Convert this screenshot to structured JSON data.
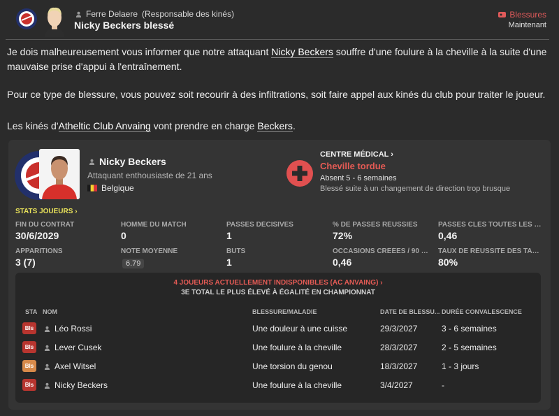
{
  "header": {
    "sender_name": "Ferre Delaere",
    "sender_role": "(Responsable des kinés)",
    "subject": "Nicky Beckers blessé",
    "category": "Blessures",
    "time": "Maintenant"
  },
  "message": {
    "p1_a": "Je dois malheureusement vous informer que notre attaquant ",
    "p1_link": "Nicky Beckers",
    "p1_b": " souffre d'une foulure à la cheville à la suite d'une mauvaise prise d'appui à l'entraînement.",
    "p2": "Pour ce type de blessure, vous pouvez soit recourir à des infiltrations, soit faire appel aux kinés du club pour traiter le joueur.",
    "p3_a": "Les kinés d'",
    "p3_club": "Atheltic Club Anvaing",
    "p3_b": " vont prendre en charge ",
    "p3_player": "Beckers",
    "p3_c": "."
  },
  "player": {
    "name": "Nicky Beckers",
    "description": "Attaquant enthousiaste de 21 ans",
    "nationality": "Belgique"
  },
  "medical": {
    "title": "CENTRE MÉDICAL",
    "injury": "Cheville tordue",
    "absence": "Absent 5 - 6 semaines",
    "cause": "Blessé suite à un changement de direction trop brusque"
  },
  "stats": {
    "title": "STATS JOUEURS",
    "items": [
      {
        "label": "FIN DU CONTRAT",
        "value": "30/6/2029"
      },
      {
        "label": "HOMME DU MATCH",
        "value": "0"
      },
      {
        "label": "PASSES DÉCISIVES",
        "value": "1"
      },
      {
        "label": "% DE PASSES RÉUSSIES",
        "value": "72%"
      },
      {
        "label": "PASSES CLÉS TOUTES LES 90...",
        "value": "0,46"
      },
      {
        "label": "APPARITIONS",
        "value": "3 (7)"
      },
      {
        "label": "NOTE MOYENNE",
        "value": "6.79"
      },
      {
        "label": "BUTS",
        "value": "1"
      },
      {
        "label": "OCCASIONS CRÉÉES / 90 MIN.",
        "value": "0,46"
      },
      {
        "label": "TAUX DE RÉUSSITE DES TACL...",
        "value": "80%"
      }
    ]
  },
  "unavailable": {
    "title": "4 JOUEURS ACTUELLEMENT INDISPONIBLES (AC ANVAING)",
    "subtitle": "3E TOTAL LE PLUS ÉLEVÉ À ÉGALITÉ EN CHAMPIONNAT",
    "columns": [
      "STA",
      "NOM",
      "BLESSURE/MALADIE",
      "DATE DE BLESSU...",
      "DURÉE CONVALESCENCE"
    ],
    "rows": [
      {
        "status": "Bls",
        "status_color": "#b8352f",
        "name": "Léo Rossi",
        "injury": "Une douleur à une cuisse",
        "date": "29/3/2027",
        "duration": "3 - 6 semaines"
      },
      {
        "status": "Bls",
        "status_color": "#b8352f",
        "name": "Lever Cusek",
        "injury": "Une foulure à la cheville",
        "date": "28/3/2027",
        "duration": "2 - 5 semaines"
      },
      {
        "status": "Bls",
        "status_color": "#d78a4a",
        "name": "Axel Witsel",
        "injury": "Une torsion du genou",
        "date": "18/3/2027",
        "duration": "1 - 3 jours"
      },
      {
        "status": "Bls",
        "status_color": "#b8352f",
        "name": "Nicky Beckers",
        "injury": "Une foulure à la cheville",
        "date": "3/4/2027",
        "duration": "-"
      }
    ]
  },
  "colors": {
    "accent_red": "#e55b55",
    "stats_title": "#e9e25a",
    "background": "#2b2b2b"
  }
}
